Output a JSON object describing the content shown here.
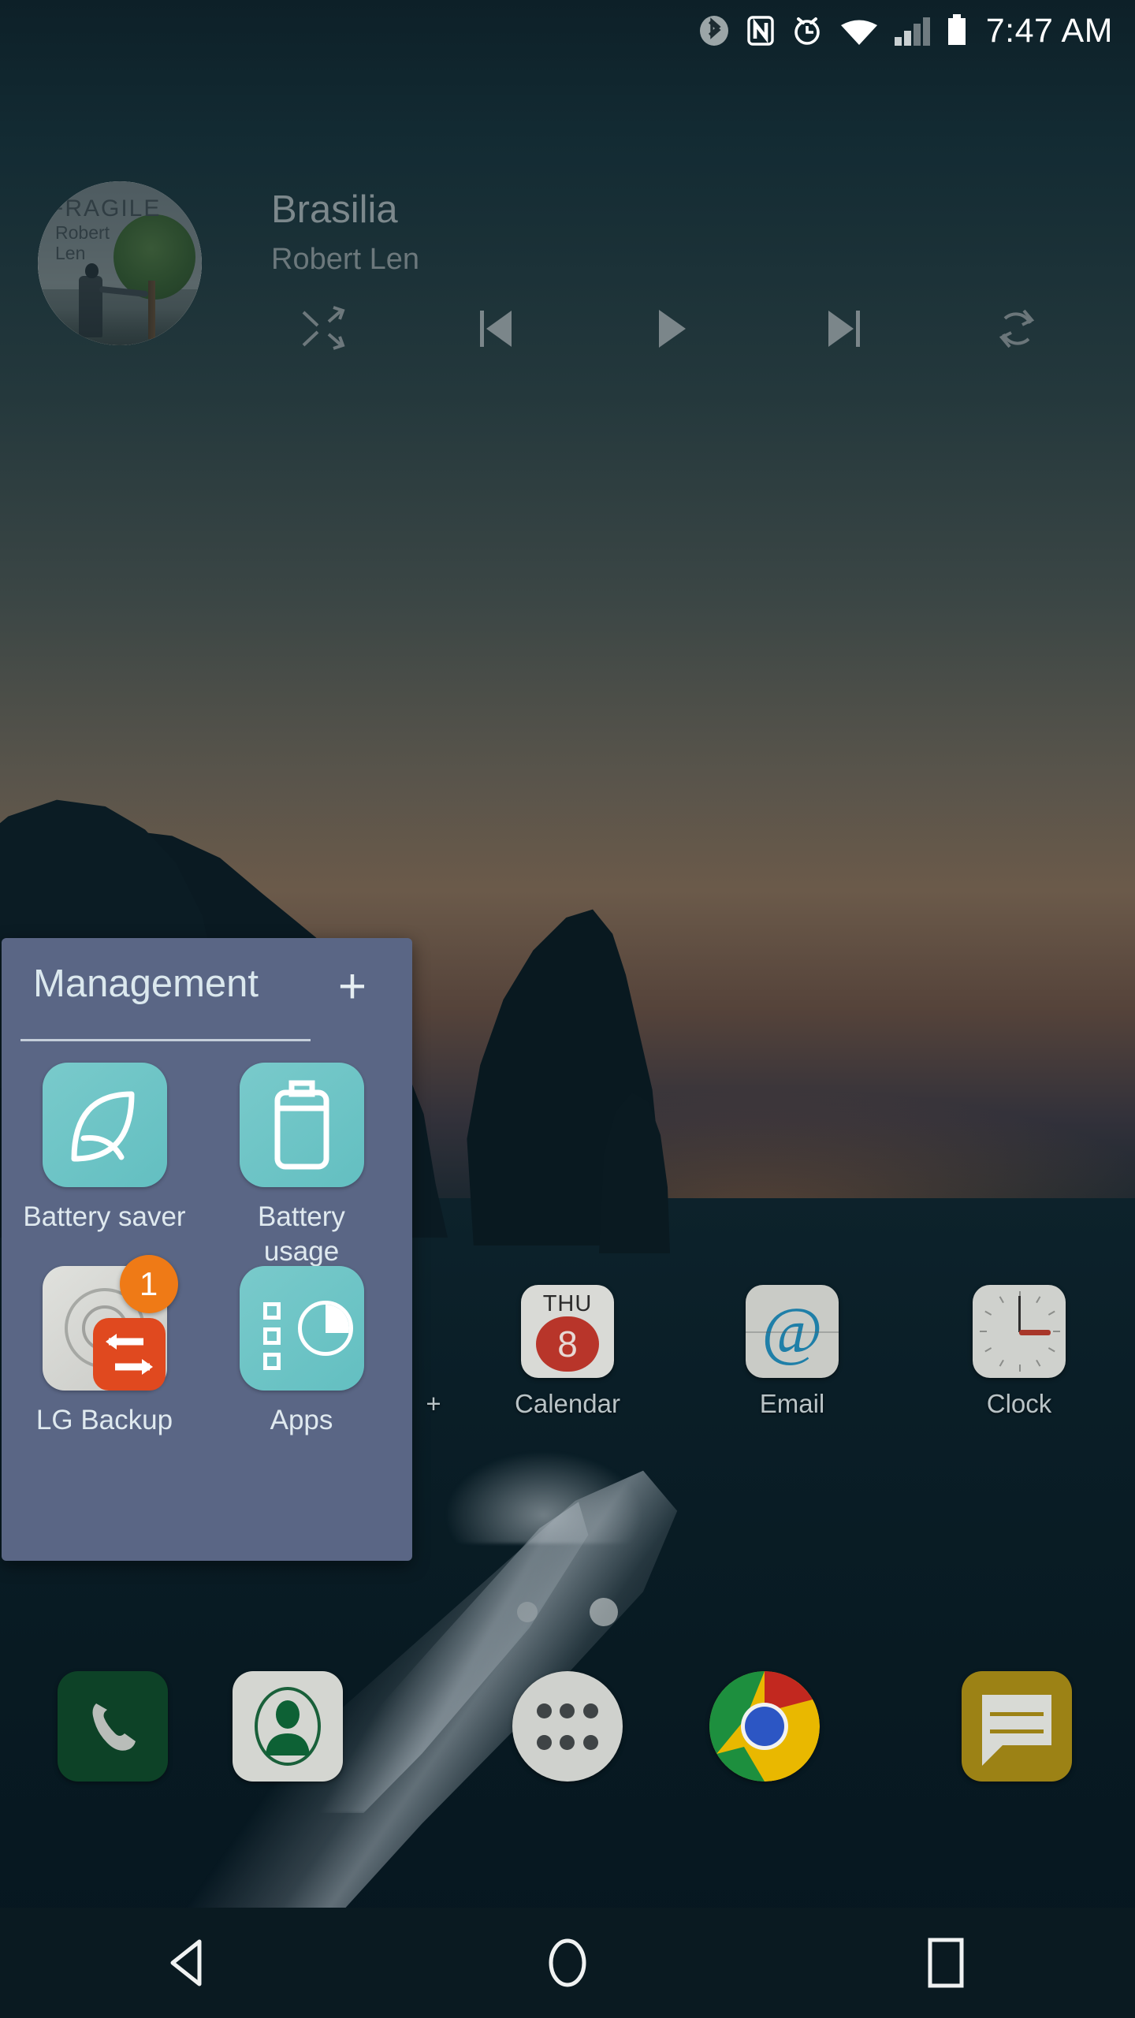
{
  "statusbar": {
    "time": "7:47 AM",
    "icons": [
      {
        "name": "bluetooth-icon",
        "state": "disabled"
      },
      {
        "name": "nfc-icon",
        "state": "active"
      },
      {
        "name": "alarm-clock-icon",
        "state": "active"
      },
      {
        "name": "wifi-icon",
        "state": "active"
      },
      {
        "name": "cellular-signal-icon",
        "state": "partial"
      },
      {
        "name": "battery-icon",
        "state": "full"
      }
    ],
    "colors": {
      "text": "#ffffff",
      "muted": "#7d8b90"
    }
  },
  "music_widget": {
    "track_title": "Brasilia",
    "artist": "Robert Len",
    "album_art": {
      "album_title": "FRAGILE",
      "album_artist_line1": "Robert",
      "album_artist_line2": "Len"
    },
    "controls": [
      {
        "name": "shuffle-button",
        "label": "Shuffle"
      },
      {
        "name": "previous-track-button",
        "label": "Previous"
      },
      {
        "name": "play-button",
        "label": "Play"
      },
      {
        "name": "next-track-button",
        "label": "Next"
      },
      {
        "name": "repeat-button",
        "label": "Repeat"
      }
    ]
  },
  "folder": {
    "title": "Management",
    "add_label": "+",
    "panel_color": "#5a6685",
    "accent_teal": "#6bc3c5",
    "apps": [
      {
        "label": "Battery saver",
        "icon": "leaf-icon",
        "badge": null
      },
      {
        "label": "Battery usage",
        "icon": "battery-outline-icon",
        "badge": null
      },
      {
        "label": "LG Backup",
        "icon": "backup-sync-icon",
        "badge": "1"
      },
      {
        "label": "Apps",
        "icon": "apps-pie-icon",
        "badge": null
      }
    ]
  },
  "home_icons": [
    {
      "label": "+",
      "icon": "google-plus-icon",
      "occluded": true
    },
    {
      "label": "Calendar",
      "icon": "calendar-icon",
      "day": "THU",
      "date": "8"
    },
    {
      "label": "Email",
      "icon": "email-at-icon"
    },
    {
      "label": "Clock",
      "icon": "analog-clock-icon"
    }
  ],
  "page_indicator": {
    "total": 2,
    "active_index": 1
  },
  "dock": [
    {
      "label": "Phone",
      "icon": "phone-handset-icon"
    },
    {
      "label": "Contacts",
      "icon": "contact-person-icon"
    },
    {
      "label": "Apps",
      "icon": "app-drawer-icon"
    },
    {
      "label": "Chrome",
      "icon": "chrome-icon"
    },
    {
      "label": "Messaging",
      "icon": "message-bubble-icon"
    }
  ],
  "navbar": [
    {
      "name": "back-button",
      "icon": "triangle-left-icon"
    },
    {
      "name": "home-button",
      "icon": "circle-icon"
    },
    {
      "name": "recents-button",
      "icon": "square-icon"
    }
  ]
}
